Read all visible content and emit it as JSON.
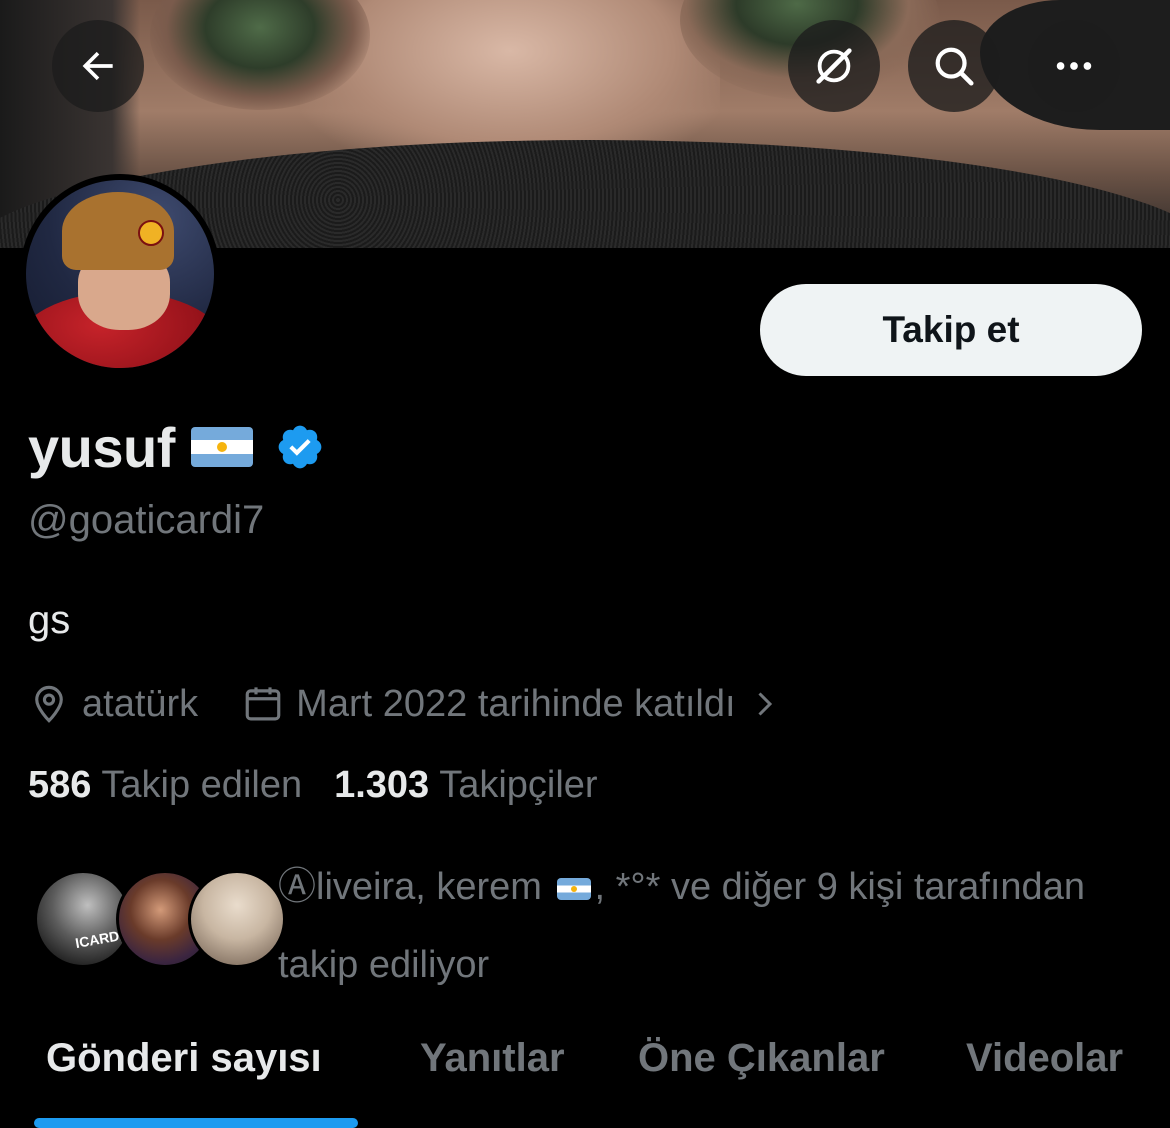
{
  "profile": {
    "name": "yusuf",
    "handle": "@goaticardi7",
    "bio": "gs",
    "location": "atatürk",
    "joined": "Mart 2022 tarihinde katıldı",
    "verified": true
  },
  "actions": {
    "follow_label": "Takip et"
  },
  "stats": {
    "following_count": "586",
    "following_label": "Takip edilen",
    "followers_count": "1.303",
    "followers_label": "Takipçiler"
  },
  "followed_by": {
    "prefix": "Ⓐliveira, kerem ",
    "suffix": ", *°* ve diğer 9 kişi tarafından takip ediliyor",
    "avatar_count": 3
  },
  "tabs": [
    {
      "label": "Gönderi sayısı",
      "active": true
    },
    {
      "label": "Yanıtlar",
      "active": false
    },
    {
      "label": "Öne Çıkanlar",
      "active": false
    },
    {
      "label": "Videolar",
      "active": false
    }
  ],
  "icons": {
    "back": "arrow-left-icon",
    "grok": "grok-icon",
    "search": "search-icon",
    "more": "more-icon",
    "location": "location-pin-icon",
    "calendar": "calendar-icon",
    "chevron": "chevron-right-icon",
    "verified": "verified-badge-icon"
  },
  "colors": {
    "background": "#000000",
    "text_primary": "#e7e9ea",
    "text_secondary": "#71767b",
    "accent": "#1d9bf0",
    "follow_button_bg": "#eff3f4",
    "follow_button_text": "#0f1419"
  }
}
